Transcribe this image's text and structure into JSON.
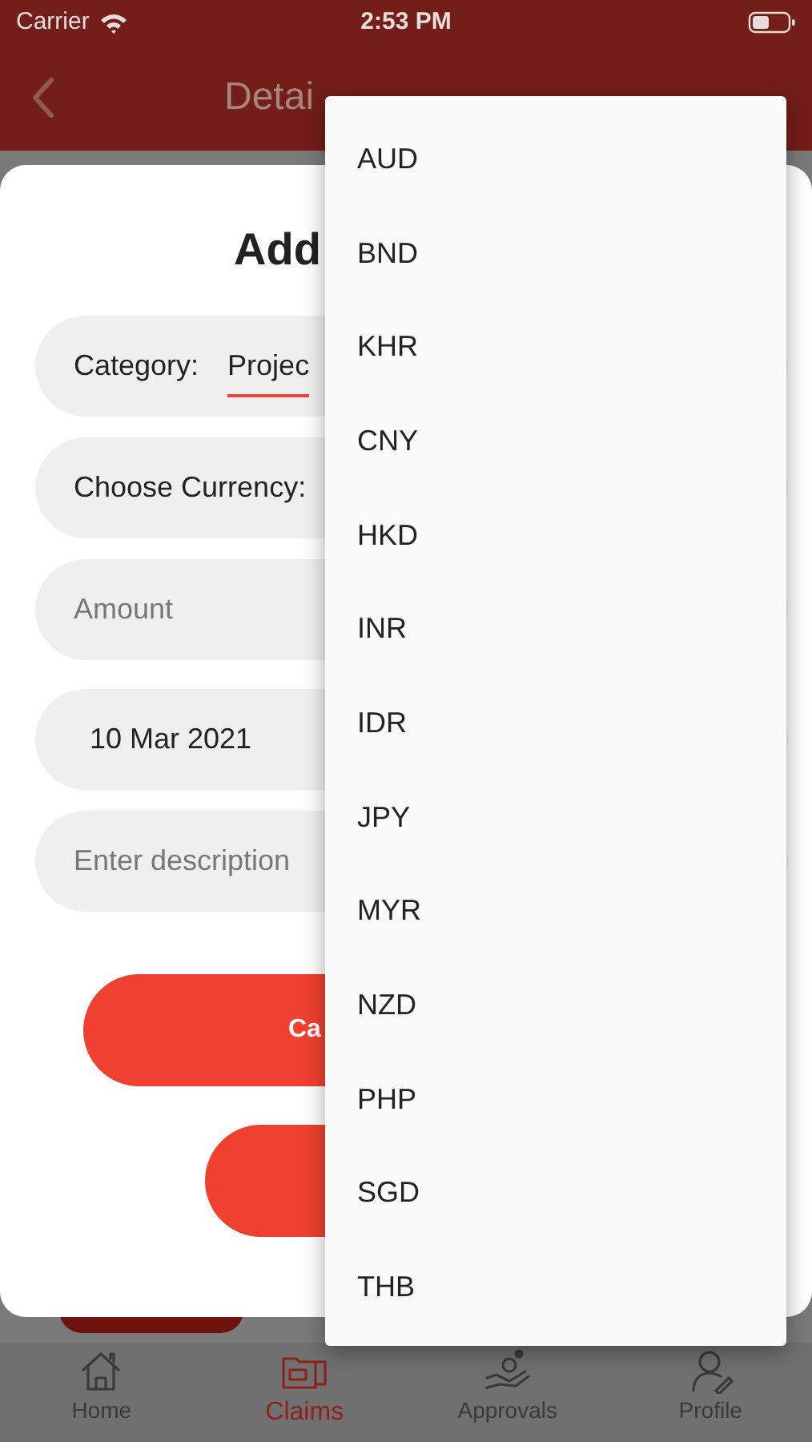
{
  "status_bar": {
    "carrier": "Carrier",
    "time": "2:53 PM"
  },
  "header": {
    "title": "Detai"
  },
  "dialog": {
    "title": "Add",
    "fields": [
      {
        "kind": "select",
        "label": "Category:",
        "value": "Projec"
      },
      {
        "kind": "label",
        "label": "Choose Currency:"
      },
      {
        "kind": "input",
        "placeholder": "Amount"
      },
      {
        "kind": "date",
        "value": "10 Mar 2021"
      },
      {
        "kind": "input",
        "placeholder": "Enter description"
      }
    ],
    "buttons": [
      {
        "label": "Ca"
      }
    ]
  },
  "currency_menu": {
    "items": [
      "AUD",
      "BND",
      "KHR",
      "CNY",
      "HKD",
      "INR",
      "IDR",
      "JPY",
      "MYR",
      "NZD",
      "PHP",
      "SGD",
      "THB"
    ]
  },
  "tab_bar": [
    {
      "label": "Home",
      "selected": false
    },
    {
      "label": "Claims",
      "selected": true
    },
    {
      "label": "Approvals",
      "selected": false
    },
    {
      "label": "Profile",
      "selected": false
    }
  ]
}
